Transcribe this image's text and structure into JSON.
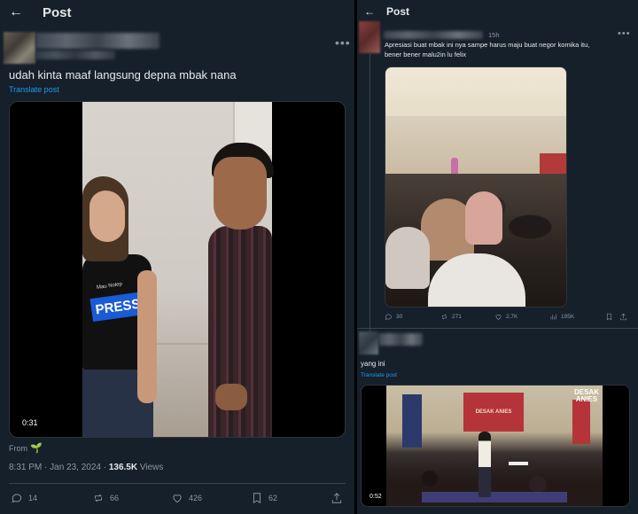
{
  "left": {
    "header": {
      "title": "Post"
    },
    "tweet": {
      "text": "udah kinta maaf langsung depna mbak nana",
      "translate": "Translate post",
      "video": {
        "duration": "0:31",
        "shirt_brand": "Mau Nolep",
        "shirt_text": "PRESS"
      },
      "from_label": "From",
      "timestamp": "8:31 PM · Jan 23, 2024 · ",
      "views_count": "136.5K",
      "views_label": " Views",
      "stats": {
        "replies": "14",
        "reposts": "66",
        "likes": "426",
        "bookmarks": "62"
      }
    }
  },
  "right": {
    "header": {
      "title": "Post"
    },
    "reply1": {
      "time": "15h",
      "text_line1": "Apresiasi buat mbak ini nya sampe harus maju buat negor komika itu,",
      "text_line2": "bener bener malu2in lu felix",
      "stats": {
        "replies": "30",
        "reposts": "271",
        "likes": "2.7K",
        "views": "195K"
      }
    },
    "reply2": {
      "text": "yang ini",
      "translate": "Translate post",
      "video": {
        "duration": "0:52",
        "banner": "DESAK ANIES",
        "logo_line1": "DESAK",
        "logo_line2": "ANIES"
      }
    }
  },
  "colors": {
    "bg": "#15202b",
    "accent": "#1d9bf0",
    "text": "#e7e9ea",
    "muted": "#8b98a5",
    "border": "#38444d"
  }
}
